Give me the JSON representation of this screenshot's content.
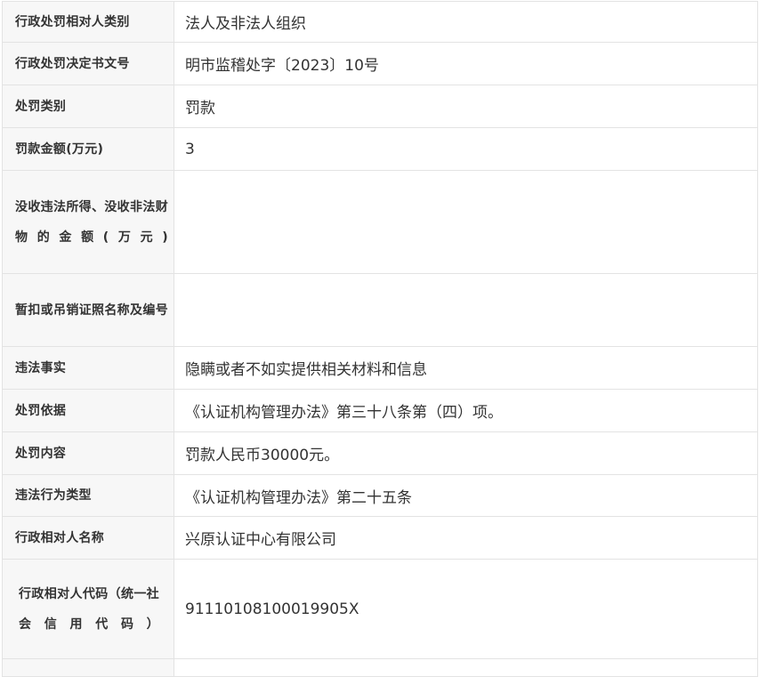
{
  "rows": [
    {
      "label": "行政处罚相对人类别",
      "value": "法人及非法人组织"
    },
    {
      "label": "行政处罚决定书文号",
      "value": "明市监稽处字〔2023〕10号"
    },
    {
      "label": "处罚类别",
      "value": "罚款"
    },
    {
      "label": "罚款金额(万元)",
      "value": "3"
    },
    {
      "label": "没收违法所得、没收非法财物的金额(万元)",
      "value": ""
    },
    {
      "label": "暂扣或吊销证照名称及编号",
      "value": ""
    },
    {
      "label": "违法事实",
      "value": "隐瞒或者不如实提供相关材料和信息"
    },
    {
      "label": "处罚依据",
      "value": "《认证机构管理办法》第三十八条第（四）项。"
    },
    {
      "label": "处罚内容",
      "value": "罚款人民币30000元。"
    },
    {
      "label": "违法行为类型",
      "value": "《认证机构管理办法》第二十五条"
    },
    {
      "label": "行政相对人名称",
      "value": "兴原认证中心有限公司"
    },
    {
      "label": "行政相对人代码（统一社会信用代码）",
      "value": "91110108100019905X"
    }
  ]
}
